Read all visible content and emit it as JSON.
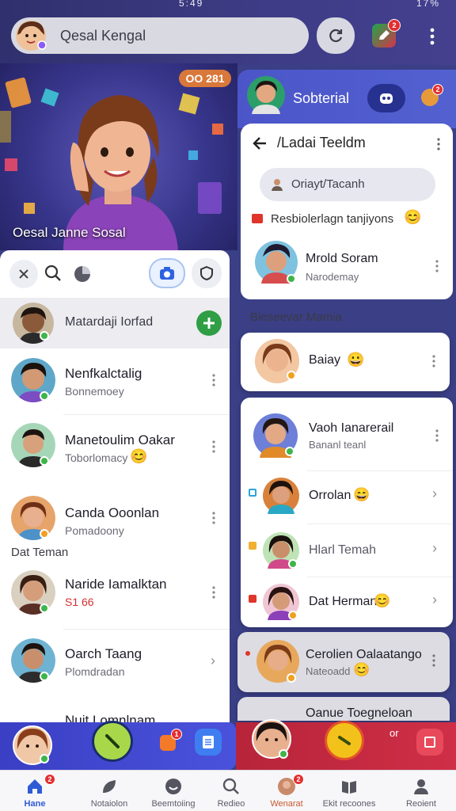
{
  "status": {
    "time": "5:49",
    "battery": "17%"
  },
  "header": {
    "search_text": "Qesal Kengal",
    "edit_badge": "2"
  },
  "hero": {
    "title": "Oesal Janne Sosal",
    "chip": "OO 281"
  },
  "left_list": {
    "pinned": {
      "name": "Matardaji Iorfad"
    },
    "chats": [
      {
        "name": "Nenfkalctalig",
        "sub": "Bonnemoey"
      },
      {
        "name": "Manetoulim Oakar",
        "sub": "Toborlomacy"
      },
      {
        "name": "Canda Ooonlan",
        "sub": "Pomadoony"
      }
    ],
    "section": "Dat Teman",
    "friends": [
      {
        "name": "Naride Iamalktan",
        "sub": "S1 66"
      },
      {
        "name": "Oarch Taang",
        "sub": "Plomdradan"
      },
      {
        "name": "Nuit Lomnlnam"
      }
    ]
  },
  "right_panel": {
    "profile_name": "Sobterial",
    "profile_badge": "2",
    "back_title": "/Ladai Teeldm",
    "search_pill": "Oriayt/Tacanh",
    "promo": "Resbiolerlagn tanjiyons",
    "top_contact": {
      "name": "Mrold Soram",
      "sub": "Narodemay"
    },
    "section": "Bieseevar Mamia",
    "single": {
      "name": "Baiay"
    },
    "contacts": [
      {
        "name": "Vaoh Ianarerail",
        "sub": "Bananl teanl"
      },
      {
        "name": "Orrolan"
      },
      {
        "name": "Hlarl Temah"
      },
      {
        "name": "Dat Herman"
      },
      {
        "name": "Cerolien Oalaatango",
        "sub": "Nateoadd"
      },
      {
        "name": "Oanue Toegneloan"
      }
    ]
  },
  "callbar": {
    "left_badge": "1",
    "right_tag": "or"
  },
  "tabs": [
    {
      "label": "Hane",
      "badge": "2"
    },
    {
      "label": "Notaiolon"
    },
    {
      "label": "Beemtoiing"
    },
    {
      "label": "Redieo"
    },
    {
      "label": "Wenarat",
      "badge": "2"
    },
    {
      "label": "Ekit recoones"
    },
    {
      "label": "Reoient"
    }
  ],
  "colors": {
    "accent": "#4a52dc",
    "call_green": "#9fd24a",
    "call_yellow": "#f3c21a",
    "danger": "#cf2f47",
    "online": "#3db54a"
  },
  "icons": [
    "search-icon",
    "refresh-icon",
    "edit-icon",
    "more-icon",
    "back-icon",
    "phone-icon",
    "home-icon",
    "leaf-icon",
    "camera-icon",
    "user-icon"
  ]
}
